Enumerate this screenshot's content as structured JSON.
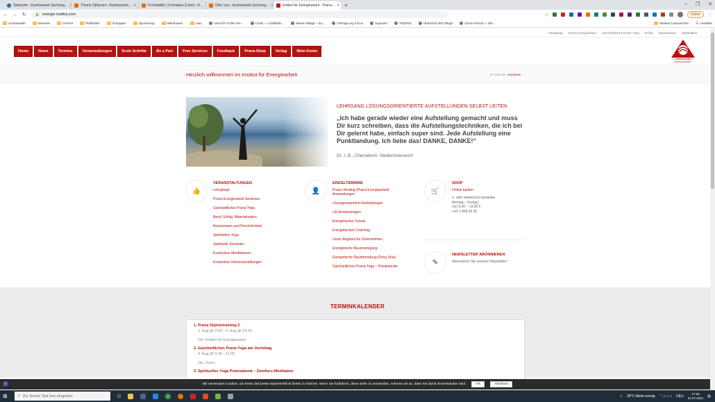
{
  "browser": {
    "tabs": [
      {
        "title": "Startseite - Austrianweb Sucheng...",
        "icon": "wordpress-icon",
        "active": false
      },
      {
        "title": "Theme Optionen ‹ Austrianweb...",
        "icon": "orange-tab-icon",
        "active": false
      },
      {
        "title": "Formidable | Formulare (Liste) ‹ A...",
        "icon": "orange-tab-icon",
        "active": false
      },
      {
        "title": "Über uns - Austrianweb Sucheng...",
        "icon": "orange-tab-icon",
        "active": false
      },
      {
        "title": "Institut für Energiearbeit - Prana...",
        "icon": "red-tab-icon",
        "active": true
      }
    ],
    "new_tab": "+",
    "url": "energie-institut.com",
    "error_chip": "Fehler",
    "bookmarks": [
      "Austrianweb",
      "Diverses",
      "Freizeit",
      "Pfadfinder",
      "Schoppen",
      "Sponsoring",
      "Webmaster",
      "Auto",
      "Ansa RT-ACMU Re...",
      "Crello — Grafikdes...",
      "Meine Ablage – Go...",
      "OnPage.org Focus",
      "Squoosh",
      "TinyPNG",
      "Übersicht SEO Blogs",
      "LEAD Horizon – Der..."
    ],
    "bookmarks_right": [
      "Weitere Lesezeichen",
      "Leseliste"
    ]
  },
  "page": {
    "topbar": [
      "Lehrgänge",
      "Prana Energiearbeit",
      "Ganzheitliches Prana Yoga",
      "Erfolg",
      "Bewusstsein",
      "Spiritualles"
    ],
    "nav": [
      "Home",
      "News",
      "Termine",
      "Veranstaltungen",
      "Erste Schritte",
      "Be a Part",
      "Free Services",
      "Feedback",
      "Prana Shop",
      "Verlag",
      "Mein Konto"
    ],
    "logo_caption": "INSTITUT FÜR ENERGIEARBEIT",
    "title": "Herzlich willkommen im Institut für Energiearbeit",
    "breadcrumb_prefix": "Du bist hier:",
    "breadcrumb_current": "Startseite",
    "hero": {
      "heading": "LEHRGANG LÖSUNGSORIENTIERTE AUFSTELLUNGEN SELBST LEITEN",
      "quote": "„Ich habe gerade wieder eine Aufstellung gemacht und muss Dir kurz schreiben, dass die Aufstellungstechniken, die ich bei Dir gelernt habe, einfach super sind. Jede Aufstellung eine Punktlandung. Ich liebe das! DANKE, DANKE!“",
      "author": "Dr. I. B., Chemikerin, Niederösterreich"
    },
    "veranstaltungen": {
      "title": "VERANSTALTUNGEN",
      "items": [
        "Lehrgänge",
        "Prana Energiearbeit Seminare",
        "Ganzheitliches Prana Yoga",
        "Beruf, Erfolg, Materialisation",
        "Bewusstsein und Persönlichkeit",
        "Spirituelles Yoga",
        "Spirituelle Seminare",
        "Kostenlose Meditationen",
        "Kostenlose Infoveranstaltungen"
      ]
    },
    "einzeltermine": {
      "title": "EINZELTERMINE",
      "items": [
        "Pranic Healing (Prana Energiearbeit) Anwendungen",
        "Lösungsorientierte Aufstellungen",
        "LIN Anwendungen",
        "Energetischer Schutz",
        "Energetisches Coaching",
        "Unser Angebot für Unternehmen",
        "Energetische Raumreinigung",
        "Energetische Raumberatung (Feng Shui)",
        "Ganzheitliches Prana Yoga – Privatstunde"
      ]
    },
    "shop": {
      "title": "SHOP",
      "online": "Online kaufen",
      "phone_intro": "oder telefonisch bestellen",
      "hours1": "Montag – Freitag",
      "hours2": "von 9:00 – 13:00 h",
      "phone": "+43 1 408 54 55"
    },
    "newsletter": {
      "title": "NEWSLETTER ABONNIEREN",
      "text": "Abonnieren Sie unseren Newsletter!"
    },
    "terminkalender": {
      "title": "TERMINKALENDER",
      "events": [
        {
          "title": "Prana Diplomtraining 2",
          "date": "2. Aug @ 9:00 - 3. Aug @ 19:00",
          "ort": "Ort: Institut für Energiearbeit"
        },
        {
          "title": "Ganzheitliches Prana Yoga am Vormittag",
          "date": "4. Aug @ 9:30 - 11:00",
          "ort": "Ort: Zoom"
        },
        {
          "title": "Spirituelles Yoga Praxisabend – Zweiherz-Meditation",
          "date": "",
          "ort": ""
        }
      ]
    },
    "cookie": {
      "text": "Wir verwenden Cookies, um Ihnen das beste Nutzererlebnis bieten zu können. Wenn Sie fortfahren, diese Seite zu verwenden, nehmen wir an, dass Sie damit einverstanden sind.",
      "ok": "OK",
      "decline": "Ablehnen"
    }
  },
  "taskbar": {
    "search_placeholder": "Zur Suche Text hier eingeben",
    "weather": "28°C  Meist sonnig",
    "lang": "DEU",
    "time": "17:29",
    "date": "31.07.2021"
  },
  "colors": {
    "accent": "#b7120e"
  }
}
